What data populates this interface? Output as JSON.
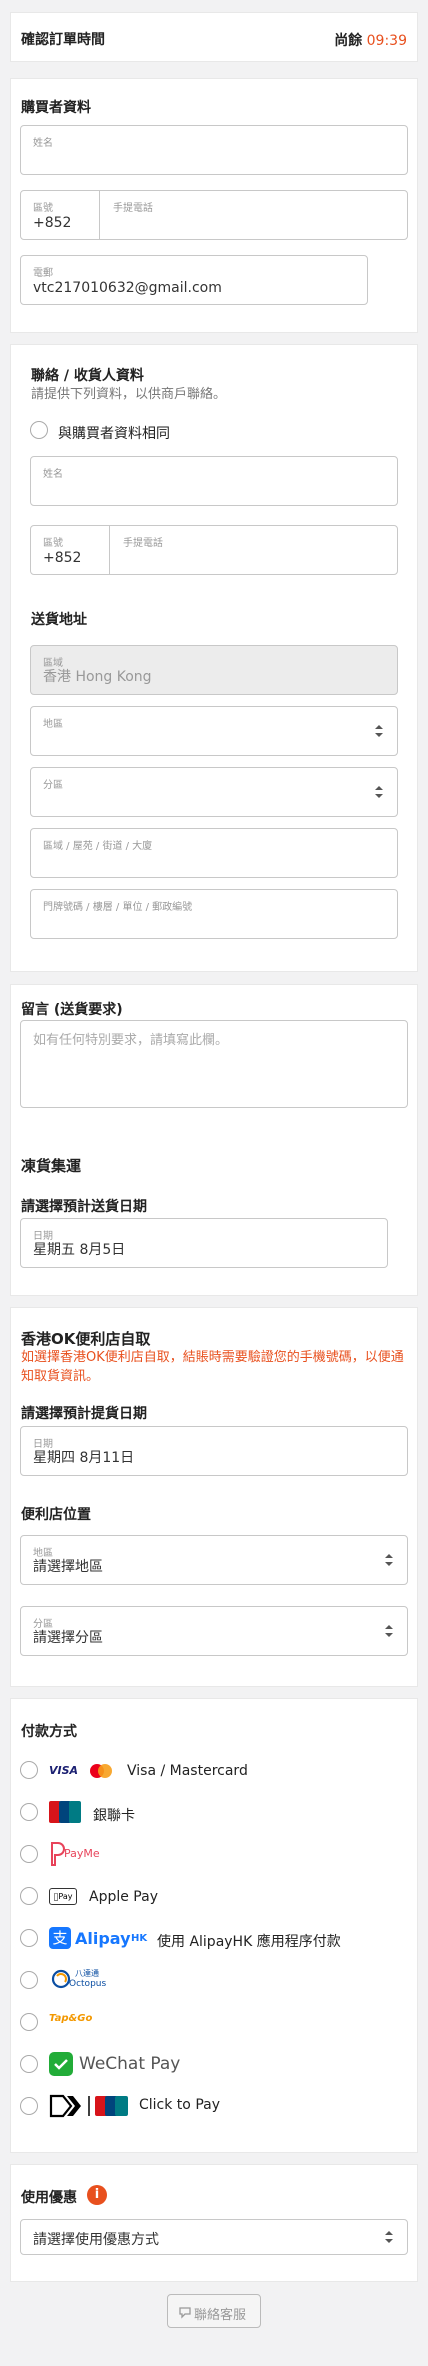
{
  "header": {
    "title": "確認訂單時間",
    "remaining_label": "尚餘",
    "remaining_time": "09:39"
  },
  "buyer": {
    "title": "購買者資料",
    "name_label": "姓名",
    "name_value": "",
    "area_label": "區號",
    "area_value": "+852",
    "phone_label": "手提電話",
    "phone_value": "",
    "email_label": "電郵",
    "email_value": "vtc217010632@gmail.com"
  },
  "recipient": {
    "title": "聯絡 / 收貨人資料",
    "subtitle": "請提供下列資料，以供商戶聯絡。",
    "same_as_buyer": "與購買者資料相同",
    "name_label": "姓名",
    "area_label": "區號",
    "area_value": "+852",
    "phone_label": "手提電話"
  },
  "address": {
    "title": "送貨地址",
    "region_label": "區域",
    "region_value": "香港 Hong Kong",
    "district_label": "地區",
    "subdistrict_label": "分區",
    "street_label": "區域 / 屋苑 / 街道 / 大廈",
    "unit_label": "門牌號碼 / 樓層 / 單位 / 郵政編號"
  },
  "message": {
    "title": "留言 (送貨要求)",
    "placeholder": "如有任何特別要求，請填寫此欄。"
  },
  "cold_chain": {
    "title": "凍貨集運",
    "date_title": "請選擇預計送貨日期",
    "date_label": "日期",
    "date_value": "星期五 8月5日"
  },
  "ok_store": {
    "title": "香港OK便利店自取",
    "notice": "如選擇香港OK便利店自取，結賬時需要驗證您的手機號碼，以便通知取貨資訊。",
    "date_title": "請選擇預計提貨日期",
    "date_label": "日期",
    "date_value": "星期四 8月11日",
    "location_title": "便利店位置",
    "district_label": "地區",
    "district_value": "請選擇地區",
    "subdistrict_label": "分區",
    "subdistrict_value": "請選擇分區"
  },
  "payment": {
    "title": "付款方式",
    "methods": [
      {
        "label": "Visa / Mastercard",
        "icon": "visa-mastercard-icon"
      },
      {
        "label": "銀聯卡",
        "icon": "unionpay-icon"
      },
      {
        "label": "PayMe",
        "icon": "payme-icon"
      },
      {
        "label": "Apple Pay",
        "icon": "apple-pay-icon"
      },
      {
        "label": "使用 AlipayHK 應用程序付款",
        "icon": "alipayhk-icon"
      },
      {
        "label": "Octopus",
        "icon": "octopus-icon"
      },
      {
        "label": "Tap & Go",
        "icon": "tapngo-icon"
      },
      {
        "label": "WeChat Pay",
        "icon": "wechat-pay-icon"
      },
      {
        "label": "Click to Pay",
        "icon": "click-to-pay-icon"
      }
    ],
    "logo_text": {
      "visa": "VISA",
      "payme": "PayMe",
      "alipay": "Alipay",
      "alipay_hk": "HK",
      "octopus_cn": "八達通",
      "octopus_en": "Octopus",
      "tapngo": "Tap&Go"
    }
  },
  "discount": {
    "title": "使用優惠",
    "info_icon": "i",
    "select_value": "請選擇使用優惠方式"
  },
  "support": {
    "label": "聯絡客服"
  },
  "colors": {
    "accent": "#e8501e",
    "background": "#f2f2f3"
  }
}
